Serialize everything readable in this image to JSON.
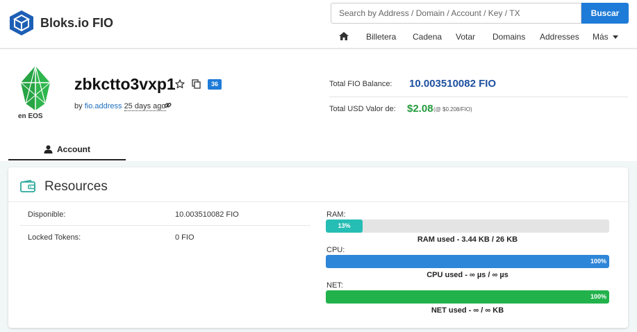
{
  "header": {
    "brand": "Bloks.io FIO",
    "search_placeholder": "Search by Address / Domain / Account / Key / TX",
    "search_button": "Buscar",
    "nav": {
      "billetera": "Billetera",
      "cadena": "Cadena",
      "votar": "Votar",
      "domains": "Domains",
      "addresses": "Addresses",
      "mas": "Más"
    }
  },
  "account": {
    "logo_text": "en EOS",
    "name": "zbkctto3vxp1",
    "badge": "36",
    "by": "by",
    "creator": "fio.address",
    "age": "25 days ago",
    "total_balance_label": "Total FIO Balance:",
    "total_balance_value": "10.003510082 FIO",
    "usd_label": "Total USD Valor de:",
    "usd_value": "$2.08",
    "usd_rate": "(@ $0.208/FIO)"
  },
  "tabs": {
    "account": "Account"
  },
  "resources": {
    "title": "Resources",
    "available_label": "Disponible:",
    "available_value": "10.003510082 FIO",
    "locked_label": "Locked Tokens:",
    "locked_value": "0 FIO",
    "ram": {
      "label": "RAM:",
      "percent": 13,
      "percent_text": "13%",
      "caption": "RAM used - 3.44 KB / 26 KB"
    },
    "cpu": {
      "label": "CPU:",
      "percent": 100,
      "percent_text": "100%",
      "caption": "CPU used - ∞ µs / ∞ µs"
    },
    "net": {
      "label": "NET:",
      "percent": 100,
      "percent_text": "100%",
      "caption": "NET used - ∞ / ∞ KB"
    }
  },
  "colors": {
    "primary": "#1f7bd8",
    "balance": "#1d4f9e",
    "usd": "#239b3c",
    "ram_bar": "#26bdb4",
    "cpu_bar": "#2e86d8",
    "net_bar": "#22b24c"
  },
  "icons": {
    "brand": "cube-icon",
    "home": "home-icon",
    "star": "star-icon",
    "copy": "copy-icon",
    "link": "link-icon",
    "user": "user-icon",
    "wallet": "wallet-icon"
  }
}
